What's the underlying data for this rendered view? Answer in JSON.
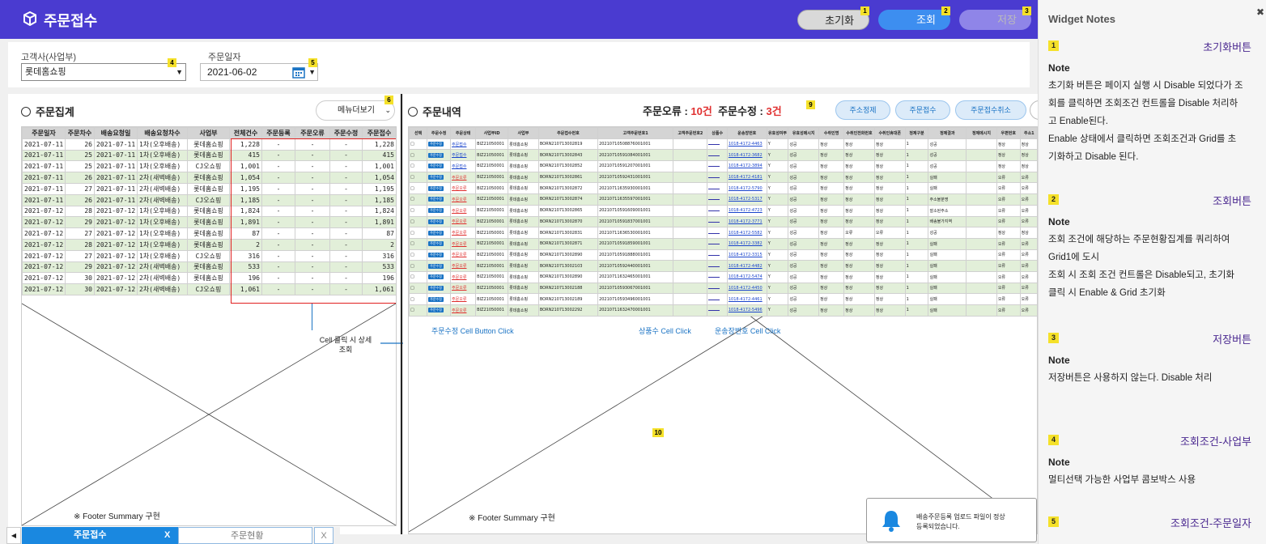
{
  "header": {
    "title": "주문접수",
    "btn_reset": "초기화",
    "btn_search": "조회",
    "btn_save": "저장",
    "pin1": "1",
    "pin2": "2",
    "pin3": "3"
  },
  "cond": {
    "customer_label": "고객사(사업부)",
    "customer_value": "롯데홈쇼핑",
    "date_label": "주문일자",
    "date_value": "2021-06-02",
    "pin4": "4",
    "pin5": "5"
  },
  "left": {
    "title": "주문집계",
    "menu_btn": "메뉴더보기",
    "pin6": "6",
    "footer": "※ Footer Summary 구현",
    "columns": [
      "주문일자",
      "주문차수",
      "배송요청일",
      "배송요청차수",
      "사업부",
      "전체건수",
      "주문등록",
      "주문오류",
      "주문수정",
      "주문접수"
    ],
    "rows": [
      [
        "2021-07-11",
        "26",
        "2021-07-11",
        "1차(오후배송)",
        "롯데홈쇼핑",
        "1,228",
        "-",
        "-",
        "-",
        "1,228"
      ],
      [
        "2021-07-11",
        "25",
        "2021-07-11",
        "1차(오후배송)",
        "롯데홈쇼핑",
        "415",
        "-",
        "-",
        "-",
        "415"
      ],
      [
        "2021-07-11",
        "25",
        "2021-07-11",
        "1차(오후배송)",
        "CJ오쇼핑",
        "1,001",
        "-",
        "-",
        "-",
        "1,001"
      ],
      [
        "2021-07-11",
        "26",
        "2021-07-11",
        "2차(새벽배송)",
        "롯데홈쇼핑",
        "1,054",
        "-",
        "-",
        "-",
        "1,054"
      ],
      [
        "2021-07-11",
        "27",
        "2021-07-11",
        "2차(새벽배송)",
        "롯데홈쇼핑",
        "1,195",
        "-",
        "-",
        "-",
        "1,195"
      ],
      [
        "2021-07-11",
        "26",
        "2021-07-11",
        "2차(새벽배송)",
        "CJ오쇼핑",
        "1,185",
        "-",
        "-",
        "-",
        "1,185"
      ],
      [
        "2021-07-12",
        "28",
        "2021-07-12",
        "1차(오후배송)",
        "롯데홈쇼핑",
        "1,824",
        "-",
        "-",
        "-",
        "1,824"
      ],
      [
        "2021-07-12",
        "29",
        "2021-07-12",
        "1차(오후배송)",
        "롯데홈쇼핑",
        "1,891",
        "-",
        "-",
        "-",
        "1,891"
      ],
      [
        "2021-07-12",
        "27",
        "2021-07-12",
        "1차(오후배송)",
        "롯데홈쇼핑",
        "87",
        "-",
        "-",
        "-",
        "87"
      ],
      [
        "2021-07-12",
        "28",
        "2021-07-12",
        "1차(오후배송)",
        "롯데홈쇼핑",
        "2",
        "-",
        "-",
        "-",
        "2"
      ],
      [
        "2021-07-12",
        "27",
        "2021-07-12",
        "1차(오후배송)",
        "CJ오쇼핑",
        "316",
        "-",
        "-",
        "-",
        "316"
      ],
      [
        "2021-07-12",
        "29",
        "2021-07-12",
        "2차(새벽배송)",
        "롯데홈쇼핑",
        "533",
        "-",
        "-",
        "-",
        "533"
      ],
      [
        "2021-07-12",
        "30",
        "2021-07-12",
        "2차(새벽배송)",
        "롯데홈쇼핑",
        "196",
        "-",
        "-",
        "-",
        "196"
      ],
      [
        "2021-07-12",
        "30",
        "2021-07-12",
        "2차(새벽배송)",
        "CJ오쇼핑",
        "1,061",
        "-",
        "-",
        "-",
        "1,061"
      ]
    ]
  },
  "annot": {
    "cell_click": "Cell 클릭 시 상세",
    "cell_click2": "조회",
    "btn_click": "주문수정 Cell Button Click",
    "prod_click": "상품수 Cell Click",
    "ship_click": "운송장번호 Cell Click",
    "pin9": "9",
    "pin10": "10"
  },
  "right": {
    "title": "주문내역",
    "err_label": "주문오류 : ",
    "err_val": "10건",
    "mod_label": "주문수정 : ",
    "mod_val": "3건",
    "btn_del": "주소정제",
    "btn_accept": "주문접수",
    "btn_cancel": "주문접수취소",
    "footer": "※ Footer Summary 구현",
    "columns": [
      "선택",
      "주문수정",
      "주문상태",
      "사업부ID",
      "사업부",
      "주문접수번호",
      "고객주문번호1",
      "고객주문번호2",
      "상품수",
      "운송장번호",
      "유효성여부",
      "유효성메시지",
      "수취인명",
      "수취인전화번호",
      "수취인휴대폰",
      "정제구분",
      "정제결과",
      "정제메시지",
      "우편번호",
      "주소1"
    ],
    "rows": [
      [
        "주문접수",
        "BIZ21050001",
        "롯데홈쇼핑",
        "BORN210713002819",
        "20210710508876001001",
        "1018-4172-4463",
        "성공",
        "정상",
        "정상",
        "정상",
        "1",
        "성공",
        "정상"
      ],
      [
        "주문접수",
        "BIZ21050001",
        "롯데홈쇼핑",
        "BORN210713002843",
        "20210710591084001001",
        "1018-4172-3682",
        "성공",
        "정상",
        "정상",
        "정상",
        "1",
        "성공",
        "정상"
      ],
      [
        "주문접수",
        "BIZ21050001",
        "롯데홈쇼핑",
        "BORN210713002852",
        "20210710591207001001",
        "1018-4172-3894",
        "성공",
        "정상",
        "정상",
        "정상",
        "1",
        "성공",
        "정상"
      ],
      [
        "주문오류",
        "BIZ21050001",
        "롯데홈쇼핑",
        "BORN210713002861",
        "20210710592431001001",
        "1018-4172-4181",
        "성공",
        "정상",
        "정상",
        "정상",
        "1",
        "실패",
        "오류"
      ],
      [
        "주문오류",
        "BIZ21050001",
        "롯데홈쇼핑",
        "BORN210713002872",
        "20210711635930001001",
        "1018-4172-5790",
        "성공",
        "정상",
        "정상",
        "정상",
        "1",
        "실패",
        "오류"
      ],
      [
        "주문오류",
        "BIZ21050001",
        "롯데홈쇼핑",
        "BORN210713002874",
        "20210711635597001001",
        "1018-4172-5317",
        "성공",
        "정상",
        "정상",
        "정상",
        "1",
        "주소불분명",
        "오류"
      ],
      [
        "주문오류",
        "BIZ21050001",
        "롯데홈쇼핑",
        "BORN210713002865",
        "20210710591609001001",
        "1018-4172-4723",
        "성공",
        "정상",
        "정상",
        "정상",
        "1",
        "잘소된주소",
        "오류"
      ],
      [
        "주문오류",
        "BIZ21050001",
        "롯데홈쇼핑",
        "BORN210713002870",
        "20210710591837001001",
        "1018-4172-3771",
        "성공",
        "정상",
        "정상",
        "정상",
        "1",
        "배송불가지역",
        "오류"
      ],
      [
        "주문오류",
        "BIZ21050001",
        "롯데홈쇼핑",
        "BORN210713002831",
        "20210711636530001001",
        "1018-4172-5582",
        "성공",
        "정상",
        "오류",
        "오류",
        "1",
        "성공",
        "정상"
      ],
      [
        "주문오류",
        "BIZ21050001",
        "롯데홈쇼핑",
        "BORN210713002871",
        "20210710591859001001",
        "1018-4172-3382",
        "성공",
        "정상",
        "정상",
        "정상",
        "1",
        "실패",
        "오류"
      ],
      [
        "주문오류",
        "BIZ21050001",
        "롯데홈쇼핑",
        "BORN210713002890",
        "20210710591888001001",
        "1018-4172-3315",
        "성공",
        "정상",
        "정상",
        "정상",
        "1",
        "실패",
        "오류"
      ],
      [
        "주문오류",
        "BIZ21050001",
        "롯데홈쇼핑",
        "BORN210713002103",
        "20210710592440001001",
        "1018-4172-4482",
        "성공",
        "정상",
        "정상",
        "정상",
        "1",
        "실패",
        "오류"
      ],
      [
        "주문오류",
        "BIZ21050001",
        "롯데홈쇼핑",
        "BORN210713002890",
        "20210711632465001001",
        "1018-4172-5474",
        "성공",
        "정상",
        "정상",
        "정상",
        "1",
        "실패",
        "오류"
      ],
      [
        "주문오류",
        "BIZ21050001",
        "롯데홈쇼핑",
        "BORN210713002188",
        "20210710593067001001",
        "1018-4172-4450",
        "성공",
        "정상",
        "정상",
        "정상",
        "1",
        "실패",
        "오류"
      ],
      [
        "주문오류",
        "BIZ21050001",
        "롯데홈쇼핑",
        "BORN210713002189",
        "20210710593496001001",
        "1018-4172-4461",
        "성공",
        "정상",
        "정상",
        "정상",
        "1",
        "실패",
        "오류"
      ],
      [
        "주문오류",
        "BIZ21050001",
        "롯데홈쇼핑",
        "BORN210713002292",
        "20210711632470001001",
        "1018-4172-5496",
        "성공",
        "정상",
        "정상",
        "정상",
        "1",
        "실패",
        "오류"
      ]
    ]
  },
  "toast": {
    "text1": "배송주문등록 업로드 파일이 정상",
    "text2": "등록되었습니다."
  },
  "tabs": {
    "tab1": "주문접수",
    "tab2": "주문현황",
    "close": "X"
  },
  "notes": {
    "title": "Widget Notes",
    "note_label": "Note",
    "items": [
      {
        "num": "1",
        "name": "초기화버튼",
        "lines": [
          "초기화 버튼은 페이지 실행 시 Disable 되었다가 조",
          "회를 클릭하면 조회조건 컨트롤을 Disable 처리하",
          "고 Enable된다.",
          "Enable 상태에서 클릭하면 조회조건과 Grid를 초",
          "기화하고 Disable 된다."
        ]
      },
      {
        "num": "2",
        "name": "조회버튼",
        "lines": [
          "조회 조건에 해당하는 주문현황집계를 쿼리하여",
          "Grid1에 도시",
          "조회 시 조회 조건 컨트롤은 Disable되고, 초기화",
          "클릭 시 Enable & Grid 초기화"
        ]
      },
      {
        "num": "3",
        "name": "저장버튼",
        "lines": [
          "저장버튼은 사용하지 않는다. Disable 처리"
        ]
      },
      {
        "num": "4",
        "name": "조회조건-사업부",
        "lines": [
          "멀티선택 가능한 사업부 콤보박스 사용"
        ]
      },
      {
        "num": "5",
        "name": "조회조건-주문일자",
        "lines": []
      }
    ]
  }
}
